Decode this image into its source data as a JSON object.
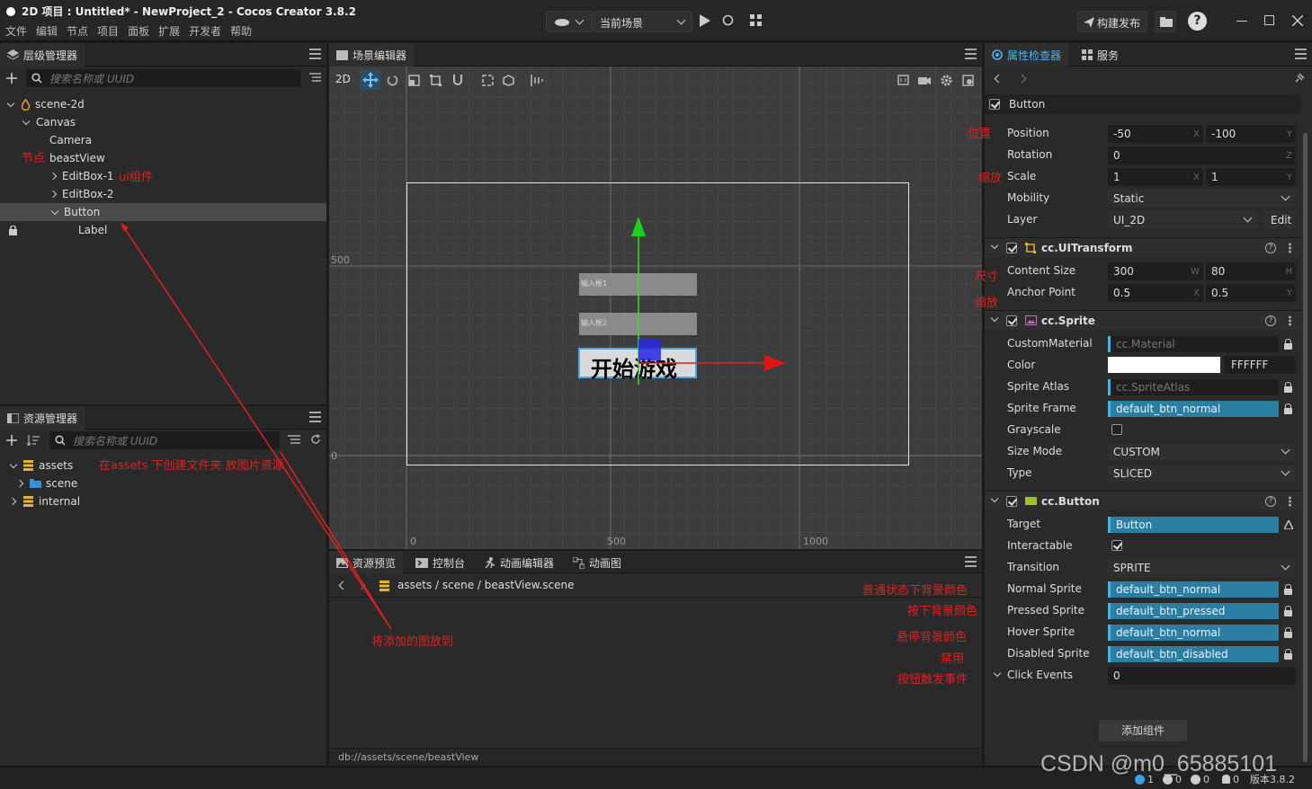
{
  "title": "2D 项目 : Untitled* - NewProject_2 - Cocos Creator 3.8.2",
  "menu": [
    "文件",
    "编辑",
    "节点",
    "项目",
    "面板",
    "扩展",
    "开发者",
    "帮助"
  ],
  "toolbar": {
    "scene_select": "当前场景",
    "build_publish": "构建发布"
  },
  "hierarchy": {
    "tab": "层级管理器",
    "search_placeholder": "搜索名称或 UUID",
    "nodes": [
      {
        "label": "scene-2d"
      },
      {
        "label": "Canvas"
      },
      {
        "label": "Camera"
      },
      {
        "label": "beastView"
      },
      {
        "label": "EditBox-1"
      },
      {
        "label": "EditBox-2"
      },
      {
        "label": "Button"
      },
      {
        "label": "Label"
      }
    ]
  },
  "assets": {
    "tab": "资源管理器",
    "search_placeholder": "搜索名称或 UUID",
    "items": [
      {
        "label": "assets"
      },
      {
        "label": "scene"
      },
      {
        "label": "internal"
      }
    ]
  },
  "scene": {
    "tab": "场景编辑器",
    "mode_2d": "2D",
    "rulers": {
      "y500": "500",
      "y0": "0",
      "x0": "0",
      "x500": "500",
      "x1000": "1000"
    },
    "editbox1": "输入框1",
    "editbox2": "输入框2",
    "button_label": "开始游戏"
  },
  "bottom": {
    "tabs": [
      "资源预览",
      "控制台",
      "动画编辑器",
      "动画图"
    ],
    "path": [
      "assets",
      "scene",
      "beastView.scene"
    ],
    "status_path": "db://assets/scene/beastView"
  },
  "inspector": {
    "tabs": [
      "属性检查器",
      "服务"
    ],
    "node_name": "Button",
    "position": {
      "label": "Position",
      "x": "-50",
      "y": "-100"
    },
    "rotation": {
      "label": "Rotation",
      "z": "0"
    },
    "scale": {
      "label": "Scale",
      "x": "1",
      "y": "1"
    },
    "mobility": {
      "label": "Mobility",
      "value": "Static"
    },
    "layer": {
      "label": "Layer",
      "value": "UI_2D",
      "edit": "Edit"
    },
    "uitransform": {
      "title": "cc.UITransform",
      "content_size": "Content Size",
      "w": "300",
      "h": "80",
      "anchor": "Anchor Point",
      "ax": "0.5",
      "ay": "0.5"
    },
    "sprite": {
      "title": "cc.Sprite",
      "custom_material": "CustomMaterial",
      "custom_material_val": "cc.Material",
      "color": "Color",
      "color_hex": "FFFFFF",
      "atlas": "Sprite Atlas",
      "atlas_val": "cc.SpriteAtlas",
      "frame": "Sprite Frame",
      "frame_val": "default_btn_normal",
      "grayscale": "Grayscale",
      "size_mode": "Size Mode",
      "size_mode_val": "CUSTOM",
      "type": "Type",
      "type_val": "SLICED"
    },
    "button": {
      "title": "cc.Button",
      "target": "Target",
      "target_val": "Button",
      "interactable": "Interactable",
      "transition": "Transition",
      "transition_val": "SPRITE",
      "normal": "Normal Sprite",
      "normal_val": "default_btn_normal",
      "pressed": "Pressed Sprite",
      "pressed_val": "default_btn_pressed",
      "hover": "Hover Sprite",
      "hover_val": "default_btn_normal",
      "disabled": "Disabled Sprite",
      "disabled_val": "default_btn_disabled",
      "click_events": "Click Events",
      "click_events_val": "0"
    },
    "add_component": "添加组件"
  },
  "annotations": {
    "node": "节点",
    "ui_component": "ui组件",
    "assets_note": "在assets 下创建文件夹 放图片资源",
    "put_image": "将添加的图放到",
    "position": "位置",
    "scale": "缩放",
    "size": "尺寸",
    "scale2": "缩放",
    "normal_bg": "普通状态下背景颜色",
    "pressed_bg": "按下背景颜色",
    "hover_bg": "悬停背景颜色",
    "disabled": "禁用",
    "click_event": "按钮触发事件"
  },
  "status": {
    "info": "1",
    "warn": "0",
    "error": "0",
    "msg": "0",
    "version": "版本3.8.2"
  },
  "watermark": "CSDN @m0_65885101",
  "colors": {
    "accent": "#2b7ea1",
    "annotation": "#e02020",
    "background": "#2a2a2a"
  }
}
